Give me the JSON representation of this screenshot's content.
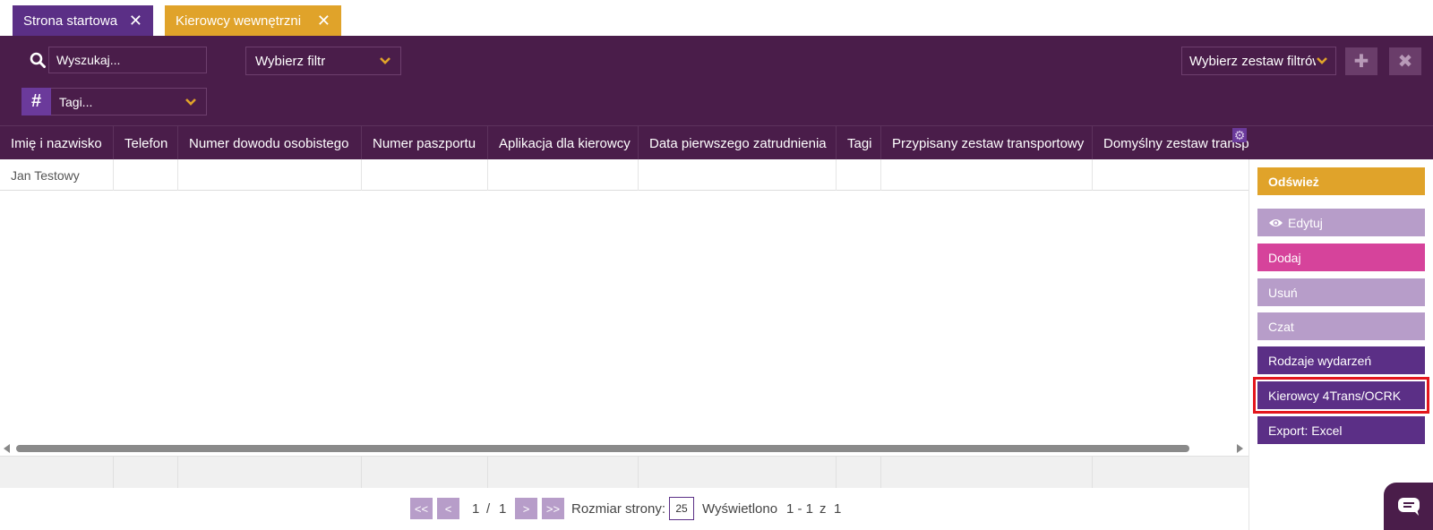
{
  "tabs": [
    {
      "label": "Strona startowa",
      "color": "#5b2f86"
    },
    {
      "label": "Kierowcy wewnętrzni",
      "color": "#e0a32a"
    }
  ],
  "toolbar": {
    "search_placeholder": "Wyszukaj...",
    "filter_select": "Wybierz filtr",
    "filter_set_select": "Wybierz zestaw filtrów",
    "tags_select": "Tagi..."
  },
  "grid": {
    "columns": [
      "Imię i nazwisko",
      "Telefon",
      "Numer dowodu osobistego",
      "Numer paszportu",
      "Aplikacja dla kierowcy",
      "Data pierwszego zatrudnienia",
      "Tagi",
      "Przypisany zestaw transportowy",
      "Domyślny zestaw transpo..."
    ],
    "rows": [
      [
        "Jan Testowy",
        "",
        "",
        "",
        "",
        "",
        "",
        "",
        ""
      ]
    ]
  },
  "pager": {
    "first": "<<",
    "prev": "<",
    "page_current": "1",
    "page_sep": "/",
    "page_total": "1",
    "next": ">",
    "last": ">>",
    "page_size_label": "Rozmiar strony:",
    "page_size_value": "25",
    "shown_label": "Wyświetlono",
    "shown_range": "1 - 1",
    "shown_of": "z",
    "shown_total": "1"
  },
  "actions": {
    "refresh": "Odśwież",
    "edit": "Edytuj",
    "add": "Dodaj",
    "delete": "Usuń",
    "chat": "Czat",
    "event_types": "Rodzaje wydarzeń",
    "drivers_4trans": "Kierowcy 4Trans/OCRK",
    "export_excel": "Export: Excel"
  },
  "colors": {
    "header_bg": "#4a1d4a",
    "accent_purple": "#5b2f86",
    "accent_gold": "#e0a32a",
    "accent_pink": "#d6439b",
    "muted_purple": "#b79dc9",
    "highlight_red": "#e3161d"
  },
  "icons": {
    "search": "search-icon",
    "tag": "hash-icon",
    "chevron": "chevron-down-icon",
    "add": "plus-icon",
    "clear": "times-icon",
    "settings": "gear-icon",
    "edit": "eye-icon",
    "chat": "chat-bubble-icon"
  }
}
